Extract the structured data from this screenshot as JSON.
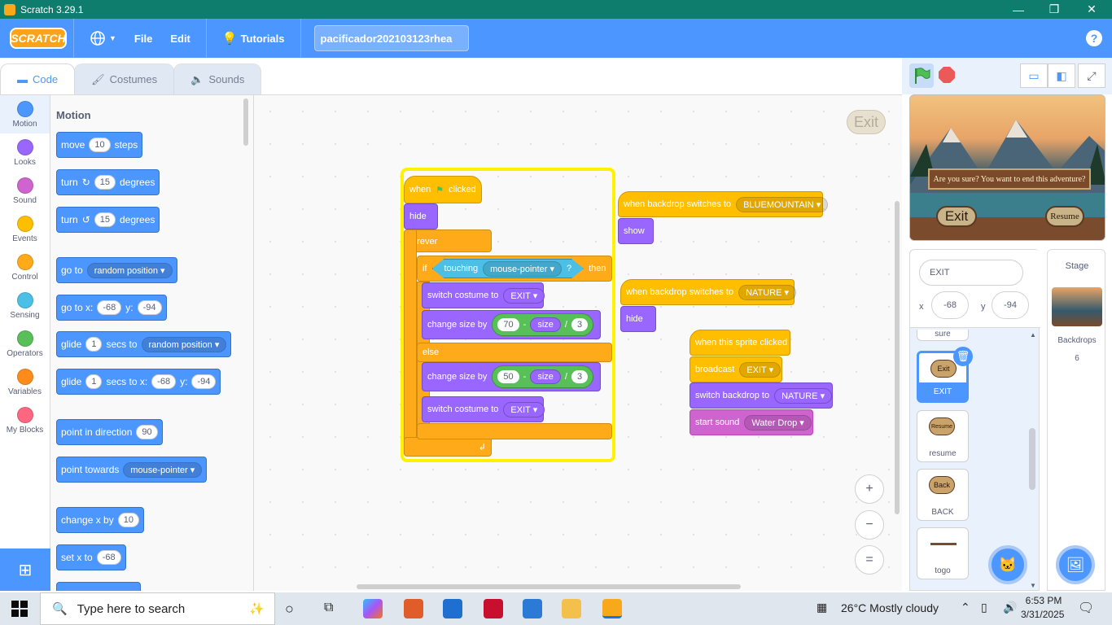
{
  "window": {
    "title": "Scratch 3.29.1",
    "min": "—",
    "restore": "❐",
    "close": "✕"
  },
  "menubar": {
    "logo": "SCRATCH",
    "file": "File",
    "edit": "Edit",
    "tutorials": "Tutorials",
    "project_name": "pacificador202103123rhea",
    "help": "?"
  },
  "tabs": {
    "code": "Code",
    "costumes": "Costumes",
    "sounds": "Sounds"
  },
  "categories": [
    {
      "label": "Motion",
      "color": "#4c97ff"
    },
    {
      "label": "Looks",
      "color": "#9966ff"
    },
    {
      "label": "Sound",
      "color": "#cf63cf"
    },
    {
      "label": "Events",
      "color": "#ffbf00"
    },
    {
      "label": "Control",
      "color": "#ffab19"
    },
    {
      "label": "Sensing",
      "color": "#4cbfe6"
    },
    {
      "label": "Operators",
      "color": "#59c059"
    },
    {
      "label": "Variables",
      "color": "#ff8c1a"
    },
    {
      "label": "My Blocks",
      "color": "#ff6680"
    }
  ],
  "palette": {
    "title": "Motion",
    "move": {
      "a": "move",
      "v": "10",
      "b": "steps"
    },
    "turn_r": {
      "a": "turn",
      "v": "15",
      "b": "degrees"
    },
    "turn_l": {
      "a": "turn",
      "v": "15",
      "b": "degrees"
    },
    "goto": {
      "a": "go to",
      "d": "random position"
    },
    "gotoxy": {
      "a": "go to x:",
      "x": "-68",
      "b": "y:",
      "y": "-94"
    },
    "glide1": {
      "a": "glide",
      "v": "1",
      "b": "secs to",
      "d": "random position"
    },
    "glide2": {
      "a": "glide",
      "v": "1",
      "b": "secs to x:",
      "x": "-68",
      "c": "y:",
      "y": "-94"
    },
    "point_dir": {
      "a": "point in direction",
      "v": "90"
    },
    "point_towards": {
      "a": "point towards",
      "d": "mouse-pointer"
    },
    "change_x": {
      "a": "change x by",
      "v": "10"
    },
    "set_x": {
      "a": "set x to",
      "v": "-68"
    }
  },
  "script1": {
    "hat_a": "when",
    "hat_b": "clicked",
    "hide": "hide",
    "forever": "forever",
    "if": "if",
    "touching": "touching",
    "touching_dd": "mouse-pointer",
    "q": "?",
    "then": "then",
    "switch1": "switch costume to",
    "switch1_dd": "EXIT",
    "change1": "change size by",
    "c1_a": "70",
    "c1_op1": "-",
    "c1_var": "size",
    "c1_op2": "/",
    "c1_b": "3",
    "else": "else",
    "change2": "change size by",
    "c2_a": "50",
    "c2_op1": "-",
    "c2_var": "size",
    "c2_op2": "/",
    "c2_b": "3",
    "switch2": "switch costume to",
    "switch2_dd": "EXIT"
  },
  "script2": {
    "hat": "when backdrop switches to",
    "dd": "BLUEMOUNTAIN",
    "show": "show"
  },
  "script3": {
    "hat": "when backdrop switches to",
    "dd": "NATURE",
    "hide": "hide"
  },
  "script4": {
    "hat": "when this sprite clicked",
    "broadcast": "broadcast",
    "broadcast_dd": "EXIT",
    "switch_bd": "switch backdrop to",
    "switch_bd_dd": "NATURE",
    "sound": "start sound",
    "sound_dd": "Water Drop"
  },
  "workspace": {
    "exit_ghost": "Exit",
    "zoom_in": "+",
    "zoom_out": "−",
    "zoom_reset": "="
  },
  "stage": {
    "dialog": "Are you sure? You want to end this adventure?",
    "exit": "Exit",
    "resume": "Resume"
  },
  "sprite_info": {
    "name": "EXIT",
    "x_label": "x",
    "x": "-68",
    "y_label": "y",
    "y": "-94"
  },
  "sprites": [
    {
      "name": "sure"
    },
    {
      "name": "EXIT",
      "thumb": "Exit"
    },
    {
      "name": "resume",
      "thumb": "Resume"
    },
    {
      "name": "BACK",
      "thumb": "Back"
    },
    {
      "name": "togo"
    }
  ],
  "stage_panel": {
    "title": "Stage",
    "backdrops_label": "Backdrops",
    "backdrops_count": "6"
  },
  "taskbar": {
    "search_placeholder": "Type here to search",
    "weather": "26°C  Mostly cloudy",
    "time": "6:53 PM",
    "date": "3/31/2025"
  }
}
